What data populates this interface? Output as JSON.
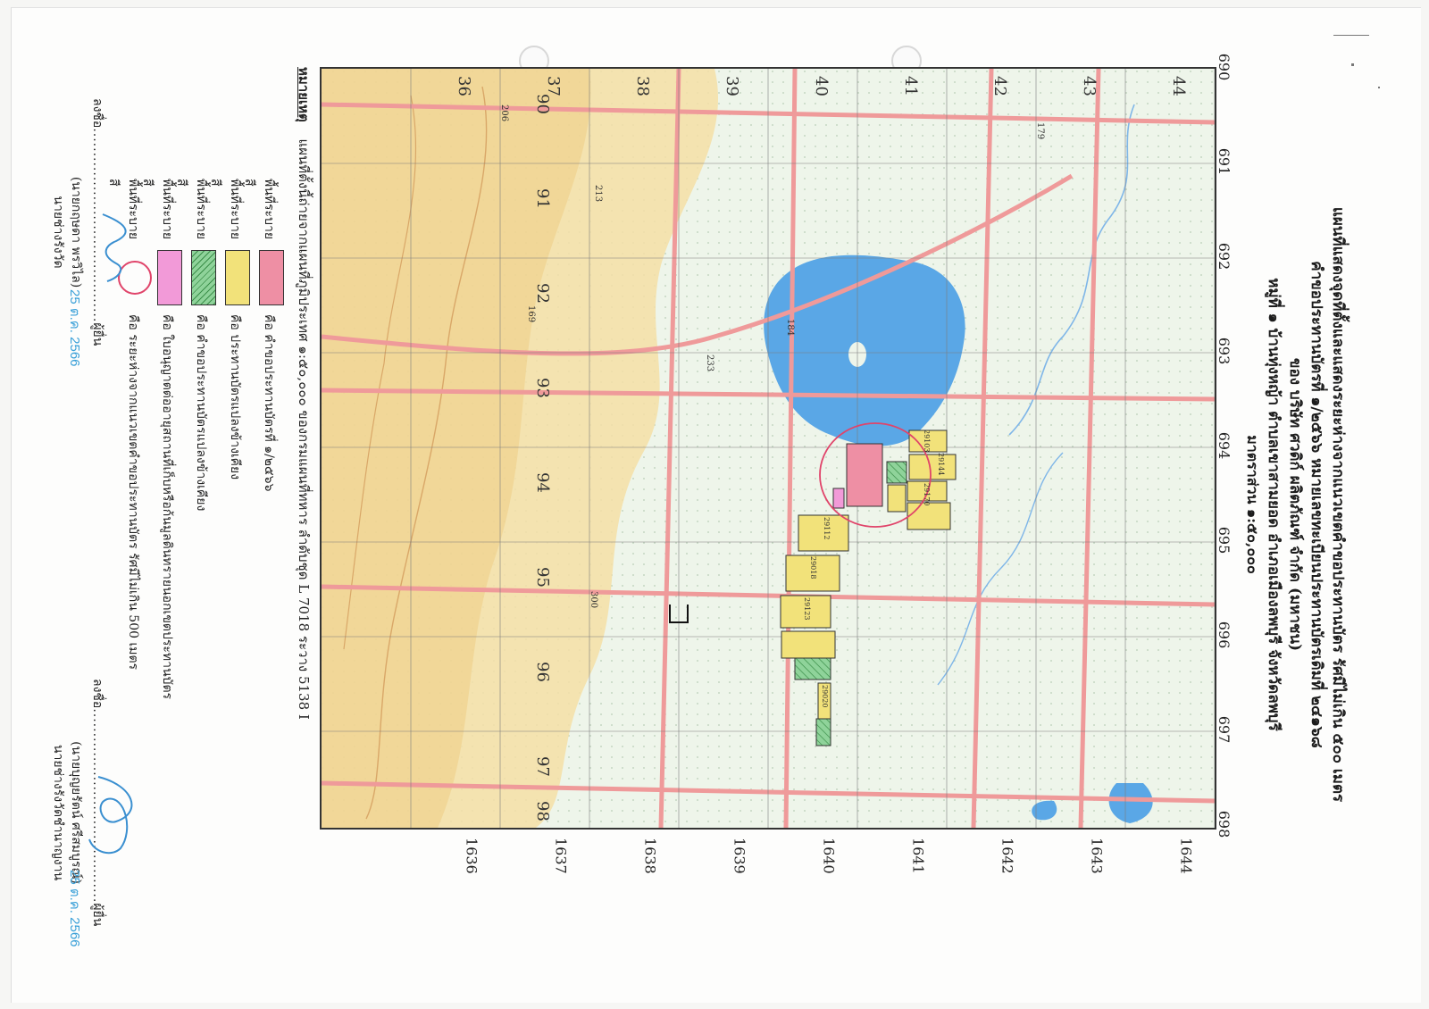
{
  "document": {
    "title_lines": [
      "แผนที่แสดงจุดที่ตั้งและแสดงระยะห่างจากแนวเขตคำขอประทานบัตร รัศมีไม่เกิน ๕๐๐ เมตร",
      "คำขอประทานบัตรที่ ๑/๒๕๖๖ หมายเลขทะเบียนประทานบัตรเดิมที่ ๒๔๑๖๘",
      "ของ บริษัท ศวดิก์ ผลิตภัณฑ์ จำกัด (มหาชน)",
      "หมู่ที่ ๑ บ้านทุ่งหญ้า ตำบลเขาสามยอด อำเภอเมืองลพบุรี จังหวัดลพบุรี",
      "มาตราส่วน ๑:๕๐,๐๐๐"
    ],
    "map_note_label": "หมายเหตุ",
    "map_note": "แผนที่ตั้งนี้ถ่ายจากแผนที่ภูมิประเทศ ๑:๕๐,๐๐๐ ของกรมแผนที่ทหาร ลำดับชุด L 7018 ระวาง 5138 I"
  },
  "map": {
    "grid_x_labels": [
      "690",
      "691",
      "692",
      "693",
      "694",
      "695",
      "696",
      "697",
      "698"
    ],
    "grid_y_labels": [
      "1636",
      "1637",
      "1638",
      "1639",
      "1640",
      "1641",
      "1642",
      "1643",
      "1644"
    ],
    "inner_x_labels": [
      "90",
      "91",
      "92",
      "93",
      "94",
      "95",
      "96",
      "97",
      "98"
    ],
    "inner_y_labels": [
      "36",
      "37",
      "38",
      "39",
      "40",
      "41",
      "42",
      "43",
      "44"
    ],
    "spot_heights": [
      "179",
      "184",
      "233",
      "206",
      "300",
      "169",
      "213"
    ],
    "parcel_labels": [
      "29144",
      "29170",
      "29103",
      "29112",
      "29018",
      "29123",
      "29020"
    ],
    "colors": {
      "concession": "#ee8fa4",
      "mining_area": "#f2e27a",
      "adjacent_request": "#8fd39a",
      "environmental_permit": "#f29ad8",
      "radius_circle": "#e0446a",
      "water": "#5aa7e6",
      "road": "#ef9a9a",
      "terrain": "#f4dfa6"
    }
  },
  "legend": [
    {
      "lead": "พื้นที่ระบายสี",
      "swatch": "concession",
      "text": "คือ คำขอประทานบัตรที่ ๑/๒๕๖๖"
    },
    {
      "lead": "พื้นที่ระบายสี",
      "swatch": "mining_area",
      "text": "คือ ประทานบัตรแปลงข้างเคียง"
    },
    {
      "lead": "พื้นที่ระบายสี",
      "swatch": "adjacent_request",
      "text": "คือ คำขอประทานบัตรแปลงข้างเคียง"
    },
    {
      "lead": "พื้นที่ระบายสี",
      "swatch": "environmental_permit",
      "text": "คือ ใบอนุญาตต่ออายุสถานที่เก็บหรือก้นมูลดินทรายนอกเขตประทานบัตร"
    },
    {
      "lead": "พื้นที่ระบายสี",
      "swatch": "radius_circle",
      "text": "คือ ระยะห่างจากแนวเขตคำขอประทานบัตร รัศมีไม่เกิน 500 เมตร"
    }
  ],
  "signatures": {
    "left": {
      "label": "ลงชื่อ",
      "role": "ผู้ยื่น",
      "name": "(นายกฤษดา พรวิไล)",
      "position": "นายช่างรังวัด",
      "date": "25 ต.ค. 2566"
    },
    "right": {
      "label": "ลงชื่อ",
      "role": "ผู้ยื่น",
      "name": "(นายบุญยรัตน์ ศรีสมบูรณ์)",
      "position": "นายช่างรังวัดชำนาญงาน",
      "date": "25 ต.ค. 2566"
    }
  }
}
